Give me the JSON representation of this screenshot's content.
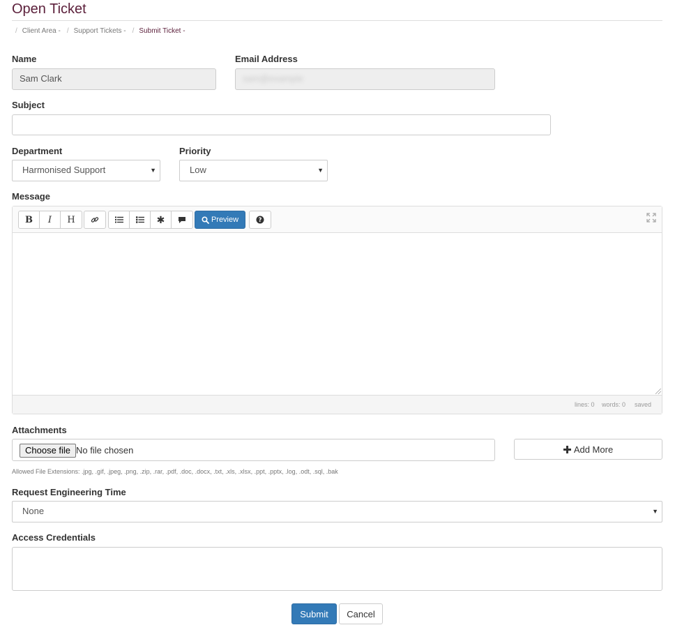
{
  "page": {
    "title": "Open Ticket"
  },
  "breadcrumb": {
    "separator": "/",
    "items": [
      {
        "label": "Client Area -"
      },
      {
        "label": "Support Tickets -"
      },
      {
        "label": "Submit Ticket -"
      }
    ]
  },
  "form": {
    "name": {
      "label": "Name",
      "value": "Sam Clark"
    },
    "email": {
      "label": "Email Address",
      "value": "sam@example"
    },
    "subject": {
      "label": "Subject",
      "value": ""
    },
    "department": {
      "label": "Department",
      "selected": "Harmonised Support"
    },
    "priority": {
      "label": "Priority",
      "selected": "Low"
    },
    "message": {
      "label": "Message",
      "toolbar": {
        "bold": "B",
        "italic": "I",
        "heading": "H",
        "link_icon": "link-icon",
        "bullet_list_icon": "bullet-list-icon",
        "numbered_list_icon": "numbered-list-icon",
        "asterisk_icon": "asterisk-icon",
        "quote_icon": "comment-icon",
        "preview_label": "Preview",
        "help_icon": "question-circle-icon",
        "fullscreen_icon": "expand-icon"
      },
      "status": {
        "lines": "lines: 0",
        "words": "words: 0",
        "saved": "saved"
      }
    },
    "attachments": {
      "label": "Attachments",
      "choose_label": "Choose file",
      "no_file_text": "No file chosen",
      "add_more_label": "Add More",
      "allowed_text": "Allowed File Extensions: .jpg, .gif, .jpeg, .png, .zip, .rar, .pdf, .doc, .docx, .txt, .xls, .xlsx, .ppt, .pptx, .log, .odt, .sql, .bak"
    },
    "engineering_time": {
      "label": "Request Engineering Time",
      "selected": "None"
    },
    "access_credentials": {
      "label": "Access Credentials",
      "value": ""
    },
    "submit_label": "Submit",
    "cancel_label": "Cancel"
  },
  "colors": {
    "title": "#5b1f3a",
    "primary_button": "#337ab7",
    "border": "#cccccc",
    "disabled_input": "#eeeeee"
  }
}
